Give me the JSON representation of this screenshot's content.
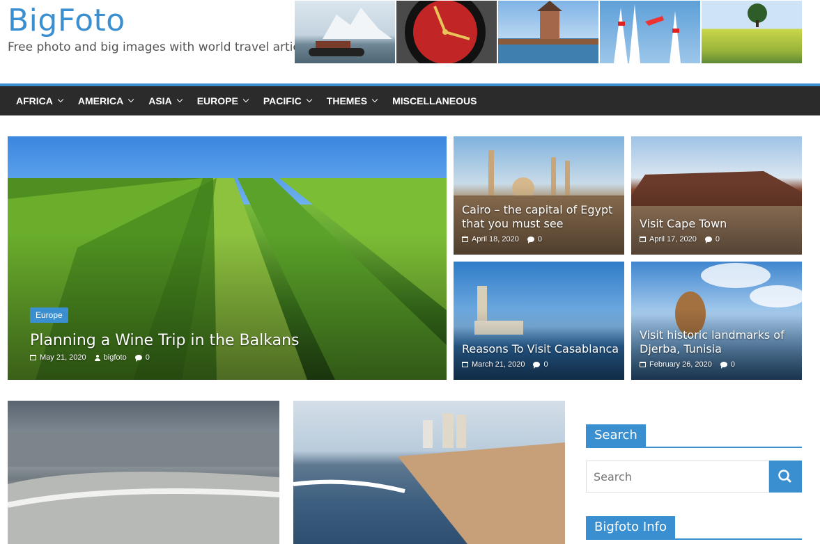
{
  "site": {
    "title": "BigFoto",
    "tagline": "Free photo and big images with world travel articles"
  },
  "nav": {
    "items": [
      {
        "label": "AFRICA",
        "has_dropdown": true
      },
      {
        "label": "AMERICA",
        "has_dropdown": true
      },
      {
        "label": "ASIA",
        "has_dropdown": true
      },
      {
        "label": "EUROPE",
        "has_dropdown": true
      },
      {
        "label": "PACIFIC",
        "has_dropdown": true
      },
      {
        "label": "THEMES",
        "has_dropdown": true
      },
      {
        "label": "MISCELLANEOUS",
        "has_dropdown": false
      }
    ]
  },
  "featured": {
    "main": {
      "category": "Europe",
      "title": "Planning a Wine Trip in the Balkans",
      "date": "May 21, 2020",
      "author": "bigfoto",
      "comments": "0"
    },
    "cards": [
      {
        "title": "Cairo – the capital of Egypt that you must see",
        "date": "April 18, 2020",
        "comments": "0"
      },
      {
        "title": "Visit Cape Town",
        "date": "April 17, 2020",
        "comments": "0"
      },
      {
        "title": "Reasons To Visit Casablanca",
        "date": "March 21, 2020",
        "comments": "0"
      },
      {
        "title": "Visit historic landmarks of Djerba, Tunisia",
        "date": "February 26, 2020",
        "comments": "0"
      }
    ]
  },
  "sidebar": {
    "search_title": "Search",
    "search_placeholder": "Search",
    "info_title": "Bigfoto Info"
  },
  "colors": {
    "accent": "#3a8fd0",
    "nav_bg": "#2b2b2b"
  }
}
